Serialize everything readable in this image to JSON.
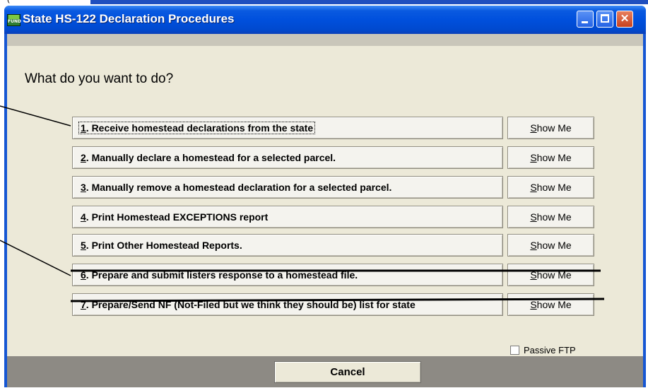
{
  "top_fragment": "(",
  "window": {
    "title": "State HS-122 Declaration Procedures",
    "icon_text": "FUND",
    "buttons": [
      "minimize-icon",
      "maximize-icon",
      "close-icon"
    ]
  },
  "prompt": "What do you want to do?",
  "options": [
    {
      "num": "1",
      "text": ". Receive homestead declarations from the state",
      "focused": true,
      "struck": false
    },
    {
      "num": "2",
      "text": ". Manually declare a homestead for a selected parcel.",
      "focused": false,
      "struck": false
    },
    {
      "num": "3",
      "text": ". Manually remove a homestead declaration for a selected parcel.",
      "focused": false,
      "struck": false
    },
    {
      "num": "4",
      "text": ". Print Homestead EXCEPTIONS report",
      "focused": false,
      "struck": false
    },
    {
      "num": "5",
      "text": ". Print Other Homestead Reports.",
      "focused": false,
      "struck": false
    },
    {
      "num": "6",
      "text": ". Prepare and submit listers response to a homestead file.",
      "focused": false,
      "struck": true
    },
    {
      "num": "7",
      "text": ". Prepare/Send NF (Not-Filed but we think they should be) list for state",
      "focused": false,
      "struck": true
    }
  ],
  "show_me": {
    "accel": "S",
    "rest": "how Me"
  },
  "passive_ftp": {
    "label": "Passive FTP",
    "checked": false
  },
  "cancel_label": "Cancel",
  "colors": {
    "titlebar": "#0050dd",
    "dialog_bg": "#ece9d8",
    "footer": "#8d8a84",
    "close_button": "#c8411f"
  }
}
